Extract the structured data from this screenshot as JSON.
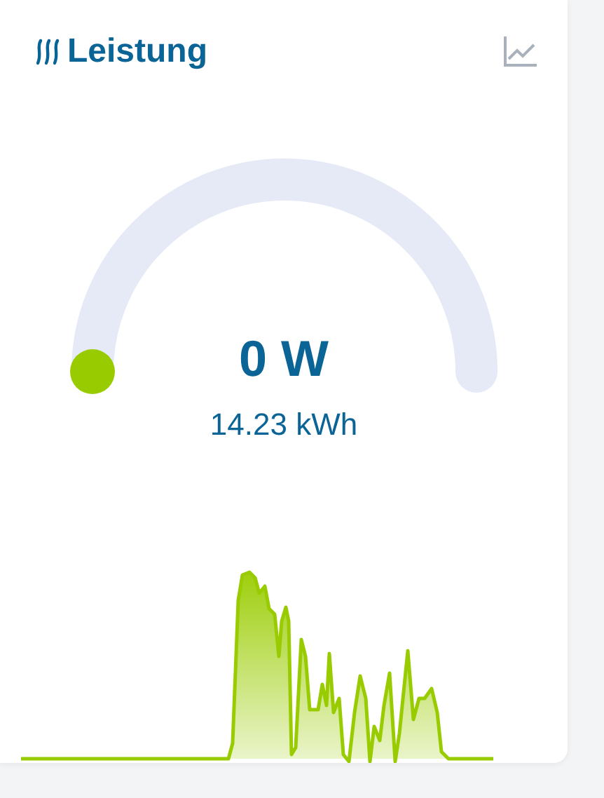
{
  "card": {
    "title": "Leistung",
    "power": "0 W",
    "energy": "14.23 kWh"
  }
}
